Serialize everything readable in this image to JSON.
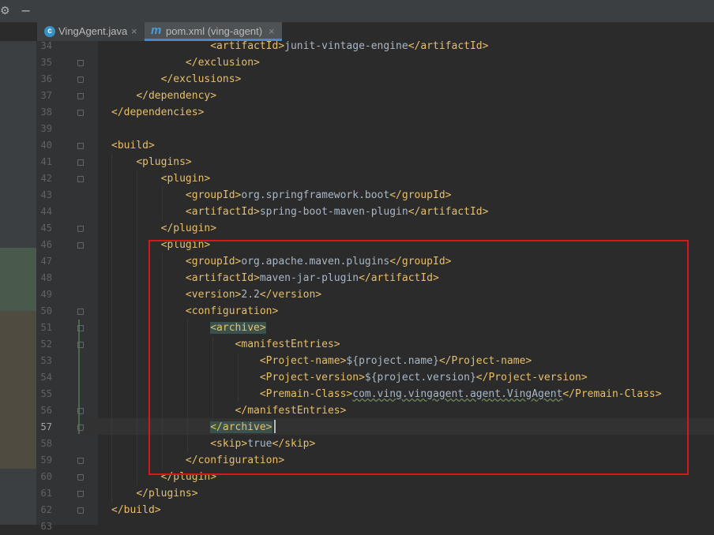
{
  "tabs": [
    {
      "label": "VingAgent.java",
      "icon": "java-class-icon",
      "icon_glyph": "c",
      "close": "×"
    },
    {
      "label": "pom.xml (ving-agent)",
      "icon": "maven-icon",
      "icon_glyph": "m",
      "close": "×"
    }
  ],
  "toolbar": {
    "gear": "⚙",
    "minimize": "−"
  },
  "editor": {
    "current_line": "57",
    "lines": [
      {
        "num": "34",
        "indent": "                ",
        "parts": [
          "<artifactId>",
          "junit-vintage-engine",
          "</artifactId>"
        ]
      },
      {
        "num": "35",
        "indent": "            ",
        "parts": [
          "</exclusion>"
        ]
      },
      {
        "num": "36",
        "indent": "        ",
        "parts": [
          "</exclusions>"
        ]
      },
      {
        "num": "37",
        "indent": "    ",
        "parts": [
          "</dependency>"
        ]
      },
      {
        "num": "38",
        "indent": "",
        "parts": [
          "</dependencies>"
        ]
      },
      {
        "num": "39",
        "indent": "",
        "parts": [
          ""
        ]
      },
      {
        "num": "40",
        "indent": "",
        "parts": [
          "<build>"
        ]
      },
      {
        "num": "41",
        "indent": "    ",
        "parts": [
          "<plugins>"
        ]
      },
      {
        "num": "42",
        "indent": "        ",
        "parts": [
          "<plugin>"
        ]
      },
      {
        "num": "43",
        "indent": "            ",
        "parts": [
          "<groupId>",
          "org.springframework.boot",
          "</groupId>"
        ]
      },
      {
        "num": "44",
        "indent": "            ",
        "parts": [
          "<artifactId>",
          "spring-boot-maven-plugin",
          "</artifactId>"
        ]
      },
      {
        "num": "45",
        "indent": "        ",
        "parts": [
          "</plugin>"
        ]
      },
      {
        "num": "46",
        "indent": "        ",
        "parts": [
          "<plugin>"
        ]
      },
      {
        "num": "47",
        "indent": "            ",
        "parts": [
          "<groupId>",
          "org.apache.maven.plugins",
          "</groupId>"
        ]
      },
      {
        "num": "48",
        "indent": "            ",
        "parts": [
          "<artifactId>",
          "maven-jar-plugin",
          "</artifactId>"
        ]
      },
      {
        "num": "49",
        "indent": "            ",
        "parts": [
          "<version>",
          "2.2",
          "</version>"
        ]
      },
      {
        "num": "50",
        "indent": "            ",
        "parts": [
          "<configuration>"
        ]
      },
      {
        "num": "51",
        "indent": "                ",
        "parts": [
          "<archive>"
        ]
      },
      {
        "num": "52",
        "indent": "                    ",
        "parts": [
          "<manifestEntries>"
        ]
      },
      {
        "num": "53",
        "indent": "                        ",
        "parts": [
          "<Project-name>",
          "${project.name}",
          "</Project-name>"
        ]
      },
      {
        "num": "54",
        "indent": "                        ",
        "parts": [
          "<Project-version>",
          "${project.version}",
          "</Project-version>"
        ]
      },
      {
        "num": "55",
        "indent": "                        ",
        "parts": [
          "<Premain-Class>",
          "com.ving.vingagent.agent.VingAgent",
          "</Premain-Class>"
        ]
      },
      {
        "num": "56",
        "indent": "                    ",
        "parts": [
          "</manifestEntries>"
        ]
      },
      {
        "num": "57",
        "indent": "                ",
        "parts": [
          "</archive>"
        ]
      },
      {
        "num": "58",
        "indent": "                ",
        "parts": [
          "<skip>",
          "true",
          "</skip>"
        ]
      },
      {
        "num": "59",
        "indent": "            ",
        "parts": [
          "</configuration>"
        ]
      },
      {
        "num": "60",
        "indent": "        ",
        "parts": [
          "</plugin>"
        ]
      },
      {
        "num": "61",
        "indent": "    ",
        "parts": [
          "</plugins>"
        ]
      },
      {
        "num": "62",
        "indent": "",
        "parts": [
          "</build>"
        ]
      },
      {
        "num": "63",
        "indent": "",
        "parts": [
          ""
        ]
      }
    ]
  },
  "colors": {
    "tag": "#e8bf6a",
    "text": "#a9b7c6",
    "highlight": "#3b514d",
    "annotation_box": "#d4181b"
  }
}
